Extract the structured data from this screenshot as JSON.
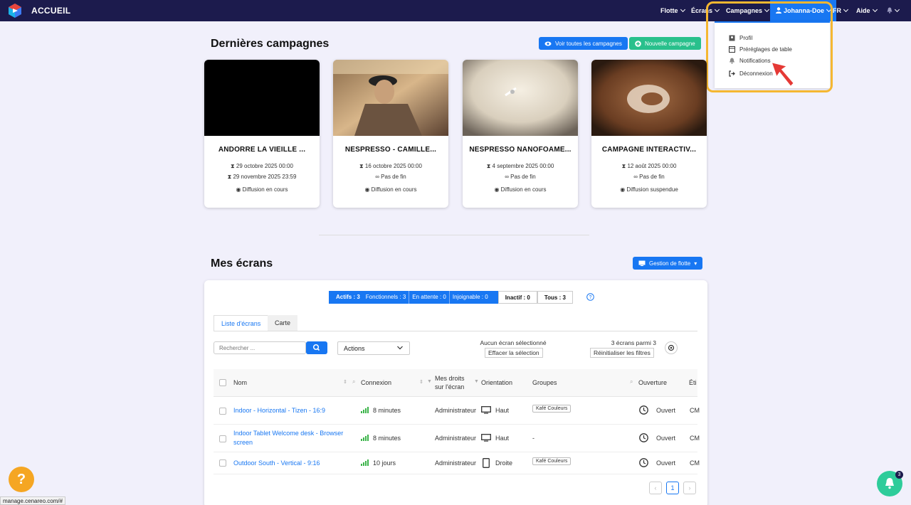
{
  "topbar": {
    "brand": "ACCUEIL",
    "nav": {
      "flotte": "Flotte",
      "ecrans": "Écrans",
      "campagnes": "Campagnes",
      "user": "Johanna-Doe",
      "lang": "FR",
      "aide": "Aide"
    }
  },
  "user_menu": {
    "items": [
      "Profil",
      "Préréglages de table",
      "Notifications",
      "Déconnexion"
    ]
  },
  "campaigns": {
    "title": "Dernières campagnes",
    "see_all": "Voir toutes les campagnes",
    "new": "Nouvelle campagne",
    "cards": [
      {
        "title": "ANDORRE LA VIEILLE ...",
        "line1": "29 octobre 2025 00:00",
        "line2": "29 novembre 2025 23:59",
        "status": "Diffusion en cours"
      },
      {
        "title": "NESPRESSO - CAMILLE...",
        "line1": "16 octobre 2025 00:00",
        "line2": "Pas de fin",
        "status": "Diffusion en cours"
      },
      {
        "title": "NESPRESSO NANOFOAME...",
        "line1": "4 septembre 2025 00:00",
        "line2": "Pas de fin",
        "status": "Diffusion en cours"
      },
      {
        "title": "CAMPAGNE INTERACTIV...",
        "line1": "12 août 2025 00:00",
        "line2": "Pas de fin",
        "status": "Diffusion suspendue"
      }
    ]
  },
  "screens": {
    "title": "Mes écrans",
    "fleet_btn": "Gestion de flotte",
    "status": {
      "actifs": "Actifs : 3",
      "fonctionnels": "Fonctionnels : 3",
      "attente": "En attente : 0",
      "injoignable": "Injoignable : 0",
      "inactif": "Inactif : 0",
      "tous": "Tous : 3"
    },
    "tabs": [
      "Liste d'écrans",
      "Carte"
    ],
    "search_placeholder": "Rechercher ...",
    "actions": "Actions",
    "no_selection": "Aucun écran sélectionné",
    "clear_selection": "Effacer la sélection",
    "count": "3 écrans parmi 3",
    "reset_filters": "Réinitialiser les filtres",
    "columns": {
      "nom": "Nom",
      "connexion": "Connexion",
      "droits1": "Mes droits",
      "droits2": "sur l'écran",
      "orientation": "Orientation",
      "groupes": "Groupes",
      "ouverture": "Ouverture",
      "etiquettes": "Éti"
    },
    "rows": [
      {
        "name1": "Indoor - Horizontal - Tizen - 16:9",
        "name2": "",
        "connexion": "8 minutes",
        "droits": "Administrateur",
        "orientation": "Haut",
        "groupe": "Kafé Couleurs",
        "ouverture": "Ouvert",
        "etiq": "CM"
      },
      {
        "name1": "Indoor Tablet Welcome desk - Browser",
        "name2": "screen",
        "connexion": "8 minutes",
        "droits": "Administrateur",
        "orientation": "Haut",
        "groupe": "-",
        "ouverture": "Ouvert",
        "etiq": "CM"
      },
      {
        "name1": "Outdoor South - Vertical - 9:16",
        "name2": "",
        "connexion": "10 jours",
        "droits": "Administrateur",
        "orientation": "Droite",
        "groupe": "Kafé Couleurs",
        "ouverture": "Ouvert",
        "etiq": "CM"
      }
    ],
    "page": "1"
  },
  "footer": {
    "url": "manage.cenareo.com/#",
    "help": "?",
    "notif_count": "3"
  },
  "colors": {
    "nav": "#1c1b4d",
    "accent": "#1877f2",
    "green": "#29c08c",
    "highlight": "#f5b731",
    "help": "#f5a623"
  }
}
